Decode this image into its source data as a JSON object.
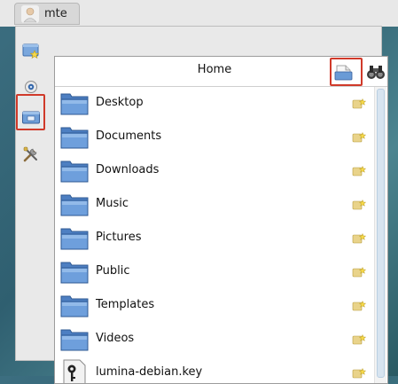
{
  "user": {
    "name": "mte"
  },
  "header": {
    "title": "Home"
  },
  "files": [
    {
      "name": "Desktop",
      "type": "folder"
    },
    {
      "name": "Documents",
      "type": "folder"
    },
    {
      "name": "Downloads",
      "type": "folder"
    },
    {
      "name": "Music",
      "type": "folder"
    },
    {
      "name": "Pictures",
      "type": "folder"
    },
    {
      "name": "Public",
      "type": "folder"
    },
    {
      "name": "Templates",
      "type": "folder"
    },
    {
      "name": "Videos",
      "type": "folder"
    },
    {
      "name": "lumina-debian.key",
      "type": "key-file"
    }
  ],
  "colors": {
    "highlight": "#d03a2a",
    "folder": "#5b8fd4"
  }
}
